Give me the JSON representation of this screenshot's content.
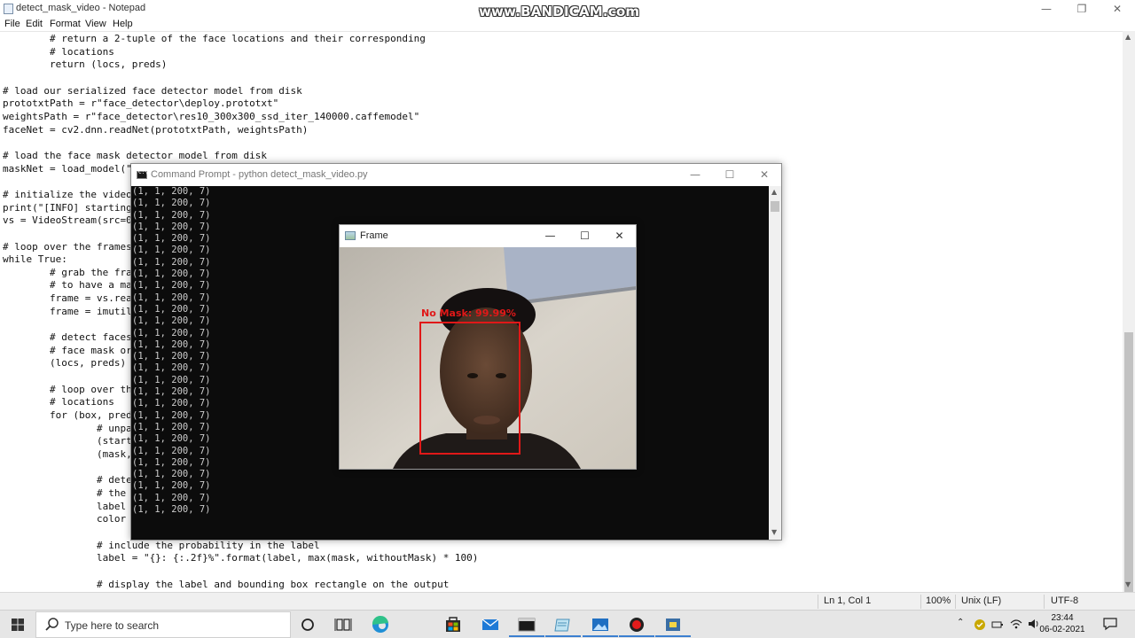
{
  "notepad": {
    "title": "detect_mask_video - Notepad",
    "menu": [
      "File",
      "Edit",
      "Format",
      "View",
      "Help"
    ],
    "lines": [
      "        # return a 2-tuple of the face locations and their corresponding",
      "        # locations",
      "        return (locs, preds)",
      "",
      "# load our serialized face detector model from disk",
      "prototxtPath = r\"face_detector\\deploy.prototxt\"",
      "weightsPath = r\"face_detector\\res10_300x300_ssd_iter_140000.caffemodel\"",
      "faceNet = cv2.dnn.readNet(prototxtPath, weightsPath)",
      "",
      "# load the face mask detector model from disk",
      "maskNet = load_model(\"",
      "",
      "# initialize the video",
      "print(\"[INFO] starting",
      "vs = VideoStream(src=0",
      "",
      "# loop over the frames",
      "while True:",
      "        # grab the fra",
      "        # to have a ma",
      "        frame = vs.rea",
      "        frame = imutil",
      "",
      "        # detect faces",
      "        # face mask or",
      "        (locs, preds)",
      "",
      "        # loop over th",
      "        # locations",
      "        for (box, pred",
      "                # unpa",
      "                (start",
      "                (mask,",
      "",
      "                # dete",
      "                # the",
      "                label",
      "                color",
      "",
      "                # include the probability in the label",
      "                label = \"{}: {:.2f}%\".format(label, max(mask, withoutMask) * 100)",
      "",
      "                # display the label and bounding box rectangle on the output"
    ],
    "status": {
      "position": "Ln 1, Col 1",
      "zoom": "100%",
      "line_ending": "Unix (LF)",
      "encoding": "UTF-8"
    }
  },
  "watermark": "www.BANDICAM.com",
  "cmd": {
    "title": "Command Prompt - python  detect_mask_video.py",
    "icon_text": "C:\\",
    "output_line": "(1, 1, 200, 7)",
    "line_count": 28
  },
  "frame": {
    "title": "Frame",
    "detection": {
      "label": "No Mask: 99.99%",
      "box_color": "#e01818"
    }
  },
  "taskbar": {
    "search_placeholder": "Type here to search",
    "time": "23:44",
    "date": "06-02-2021",
    "apps": [
      "task-view-icon",
      "edge-icon",
      "store-icon",
      "mail-icon",
      "cmd-icon",
      "notepad-icon",
      "photos-icon",
      "bandicam-icon",
      "python-icon"
    ]
  },
  "colors": {
    "cmd_background": "#0c0c0c",
    "cmd_text": "#cccccc",
    "taskbar": "#e6e6e6"
  }
}
